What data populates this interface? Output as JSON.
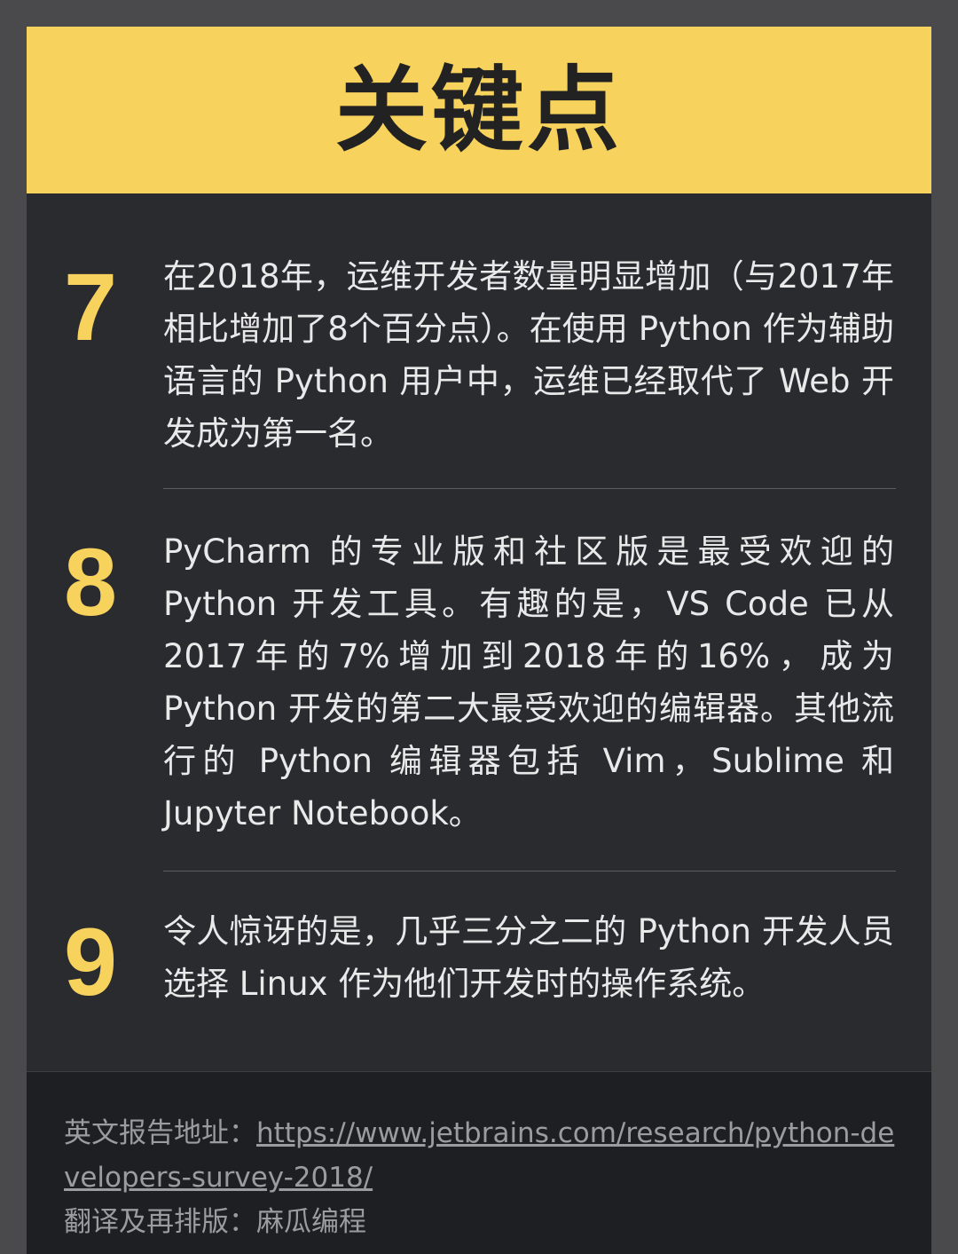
{
  "header": {
    "title": "关键点"
  },
  "items": [
    {
      "number": "7",
      "text": "在2018年，运维开发者数量明显增加（与2017年相比增加了8个百分点）。在使用 Python 作为辅助语言的 Python 用户中，运维已经取代了 Web 开发成为第一名。"
    },
    {
      "number": "8",
      "text": "PyCharm 的专业版和社区版是最受欢迎的 Python 开发工具。有趣的是，VS Code 已从 2017年的7%增加到2018年的16%，成为 Python 开发的第二大最受欢迎的编辑器。其他流行的 Python 编辑器包括 Vim，Sublime 和 Jupyter Notebook。"
    },
    {
      "number": "9",
      "text": "令人惊讶的是，几乎三分之二的 Python 开发人员选择 Linux 作为他们开发时的操作系统。"
    }
  ],
  "footer": {
    "report_label": "英文报告地址：",
    "report_url": "https://www.jetbrains.com/research/python-developers-survey-2018/",
    "credit": "翻译及再排版：麻瓜编程"
  },
  "colors": {
    "accent": "#f7d25c",
    "card_background": "#2a2b2f",
    "page_background": "#4a4a4c",
    "text": "#e9e9ea"
  }
}
